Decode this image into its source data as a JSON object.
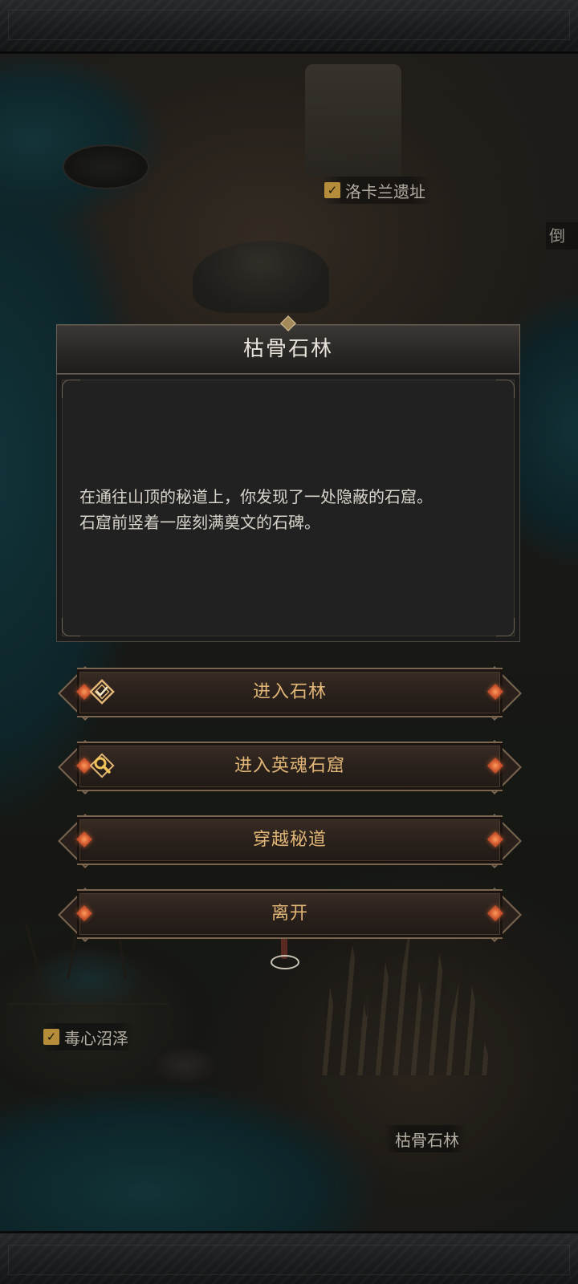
{
  "map": {
    "locations": [
      {
        "name": "洛卡兰遗址",
        "cleared": true
      },
      {
        "name": "倒",
        "cleared": false
      },
      {
        "name": "毒心沼泽",
        "cleared": true
      },
      {
        "name": "枯骨石林",
        "cleared": false
      }
    ]
  },
  "dialog": {
    "title": "枯骨石林",
    "lines": [
      "在通往山顶的秘道上，你发现了一处隐蔽的石窟。",
      "石窟前竖着一座刻满奠文的石碑。"
    ]
  },
  "options": [
    {
      "label": "进入石林",
      "icon": "check-diamond-icon"
    },
    {
      "label": "进入英魂石窟",
      "icon": "magnifier-icon"
    },
    {
      "label": "穿越秘道",
      "icon": ""
    },
    {
      "label": "离开",
      "icon": ""
    }
  ],
  "colors": {
    "option_text": "#e1b677",
    "gem": "#c8502a",
    "check": "#b48c3a"
  }
}
